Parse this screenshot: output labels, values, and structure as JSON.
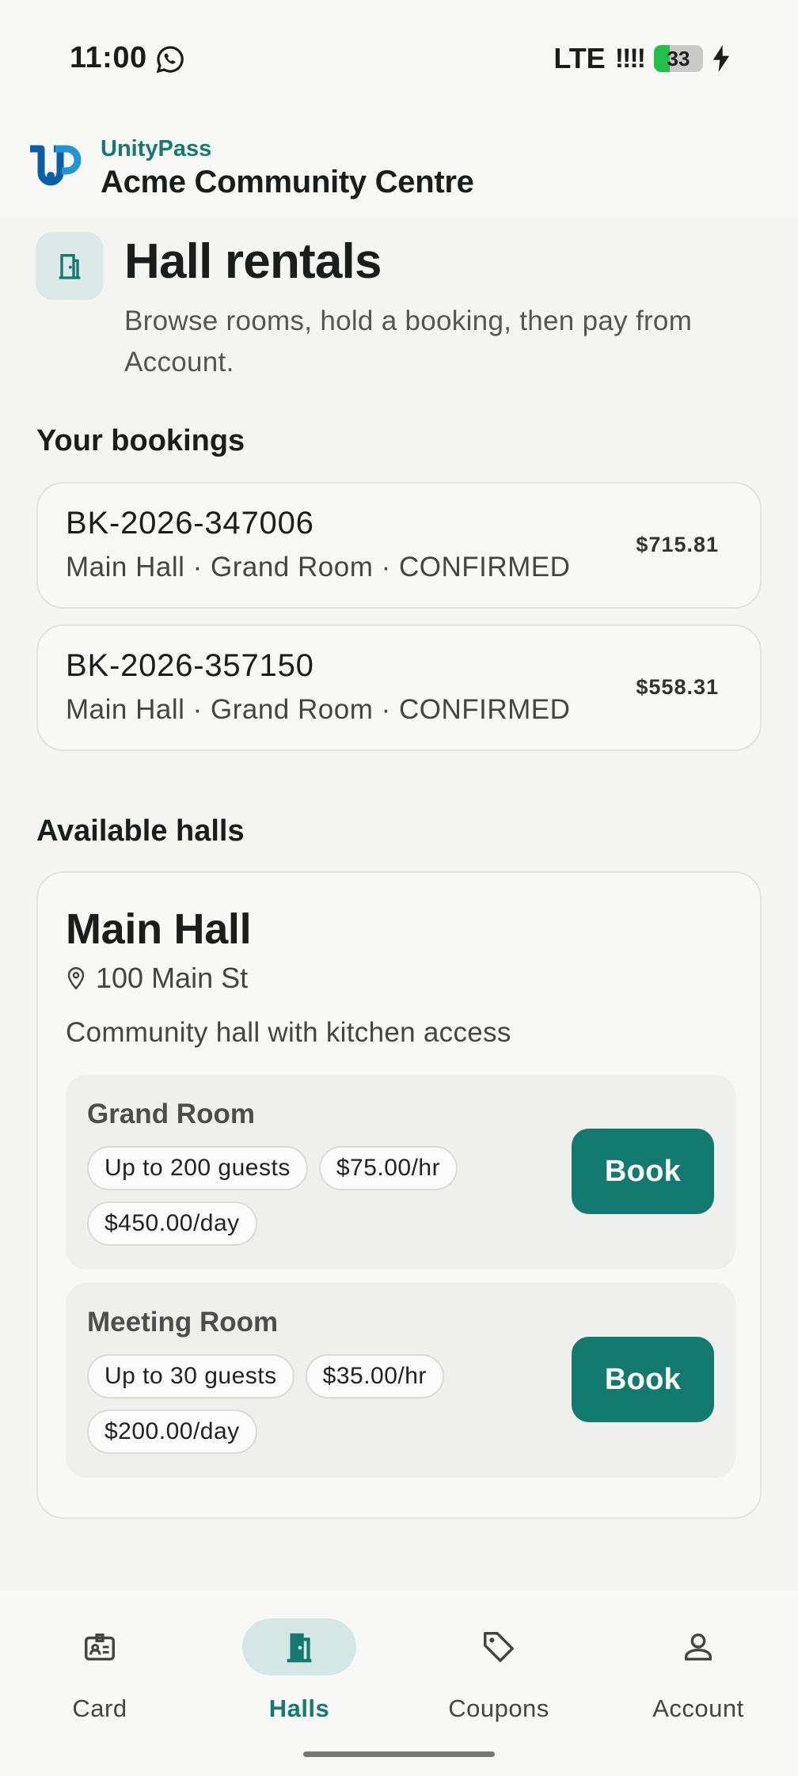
{
  "status_bar": {
    "time": "11:00",
    "network": "LTE",
    "signal": "!!!!",
    "battery": "33",
    "battery_color": "#22c04a"
  },
  "header": {
    "brand": "UnityPass",
    "org_name": "Acme Community Centre",
    "logo_icon": "unitypass-logo"
  },
  "page": {
    "title": "Hall rentals",
    "subtitle": "Browse rooms, hold a booking, then pay from Account.",
    "icon": "door-icon"
  },
  "bookings": {
    "section_title": "Your bookings",
    "items": [
      {
        "id": "BK-2026-347006",
        "meta": "Main Hall · Grand Room · CONFIRMED",
        "amount": "$715.81"
      },
      {
        "id": "BK-2026-357150",
        "meta": "Main Hall · Grand Room · CONFIRMED",
        "amount": "$558.31"
      }
    ]
  },
  "halls": {
    "section_title": "Available halls",
    "items": [
      {
        "name": "Main Hall",
        "address": "100 Main St",
        "description": "Community hall with kitchen access",
        "rooms": [
          {
            "name": "Grand Room",
            "capacity": "Up to 200 guests",
            "hourly": "$75.00/hr",
            "daily": "$450.00/day",
            "action": "Book"
          },
          {
            "name": "Meeting Room",
            "capacity": "Up to 30 guests",
            "hourly": "$35.00/hr",
            "daily": "$200.00/day",
            "action": "Book"
          }
        ]
      }
    ]
  },
  "nav": {
    "items": [
      {
        "label": "Card",
        "icon": "id-card-icon"
      },
      {
        "label": "Halls",
        "icon": "door-icon",
        "active": true
      },
      {
        "label": "Coupons",
        "icon": "tag-icon"
      },
      {
        "label": "Account",
        "icon": "person-icon"
      }
    ]
  },
  "colors": {
    "accent": "#137a6f",
    "brand_text": "#16796f",
    "active_nav_bg": "#d4e7e4"
  }
}
